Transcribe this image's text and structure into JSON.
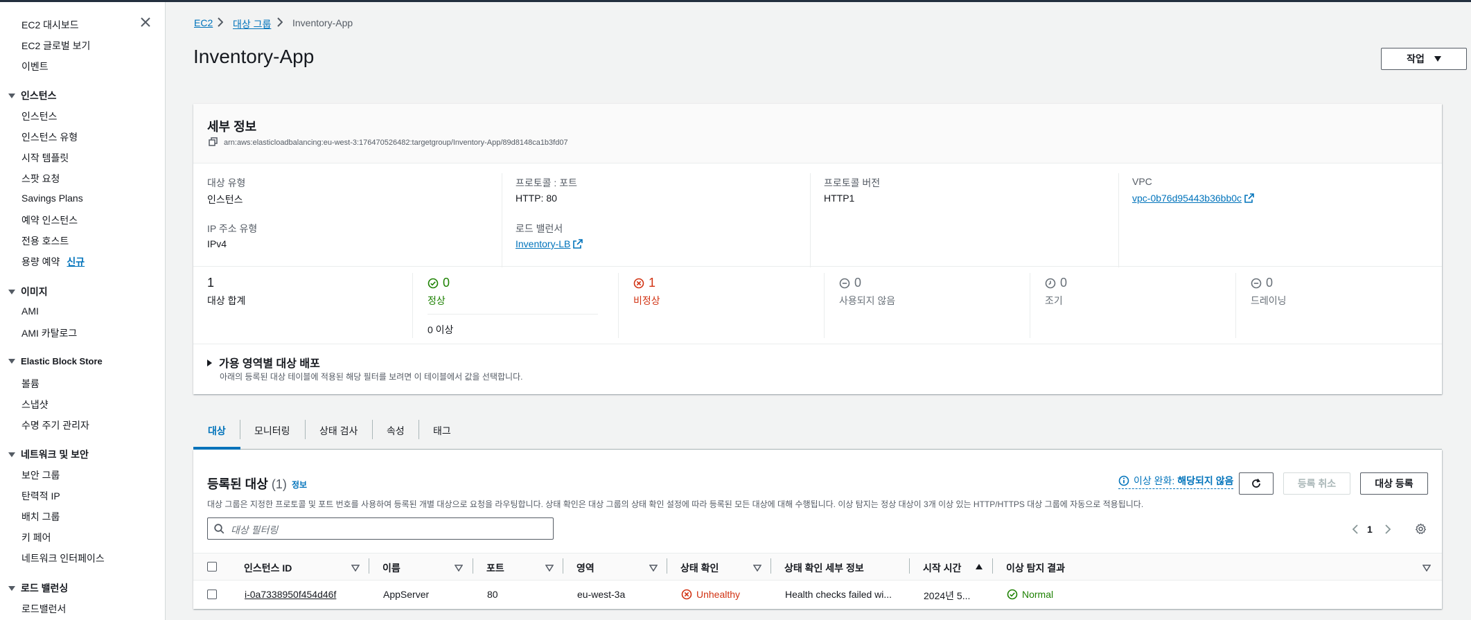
{
  "sidebar": {
    "items_top": [
      "EC2 대시보드",
      "EC2 글로벌 보기",
      "이벤트"
    ],
    "sec_instances": "인스턴스",
    "instances": [
      "인스턴스",
      "인스턴스 유형",
      "시작 템플릿",
      "스팟 요청",
      "Savings Plans",
      "예약 인스턴스",
      "전용 호스트",
      "용량 예약"
    ],
    "new_badge": "신규",
    "sec_images": "이미지",
    "images": [
      "AMI",
      "AMI 카탈로그"
    ],
    "sec_ebs": "Elastic Block Store",
    "ebs": [
      "볼륨",
      "스냅샷",
      "수명 주기 관리자"
    ],
    "sec_network": "네트워크 및 보안",
    "network": [
      "보안 그룹",
      "탄력적 IP",
      "배치 그룹",
      "키 페어",
      "네트워크 인터페이스"
    ],
    "sec_lb": "로드 밸런싱",
    "lb": [
      "로드밸런서"
    ]
  },
  "breadcrumb": {
    "ec2": "EC2",
    "target_groups": "대상 그룹",
    "current": "Inventory-App"
  },
  "page": {
    "title": "Inventory-App",
    "actions_label": "작업"
  },
  "details": {
    "title": "세부 정보",
    "arn": "arn:aws:elasticloadbalancing:eu-west-3:176470526482:targetgroup/Inventory-App/89d8148ca1b3fd07",
    "target_type_label": "대상 유형",
    "target_type_value": "인스턴스",
    "protocol_port_label": "프로토콜 : 포트",
    "protocol_port_value": "HTTP: 80",
    "protocol_version_label": "프로토콜 버전",
    "protocol_version_value": "HTTP1",
    "vpc_label": "VPC",
    "vpc_value": "vpc-0b76d95443b36bb0c",
    "ip_type_label": "IP 주소 유형",
    "ip_type_value": "IPv4",
    "lb_label": "로드 밸런서",
    "lb_value": "Inventory-LB"
  },
  "counts": {
    "total_value": "1",
    "total_label": "대상 합계",
    "healthy_value": "0",
    "healthy_label": "정상",
    "anomaly_value": "0 이상",
    "unhealthy_value": "1",
    "unhealthy_label": "비정상",
    "unused_value": "0",
    "unused_label": "사용되지 않음",
    "initial_value": "0",
    "initial_label": "조기",
    "draining_value": "0",
    "draining_label": "드레이닝"
  },
  "az": {
    "title": "가용 영역별 대상 배포",
    "desc": "아래의 등록된 대상 테이블에 적용된 해당 필터를 보려면 이 테이블에서 값을 선택합니다."
  },
  "tabs": [
    "대상",
    "모니터링",
    "상태 검사",
    "속성",
    "태그"
  ],
  "registered": {
    "title": "등록된 대상",
    "count": "(1)",
    "info": "정보",
    "mitigation_label": "이상 완화:",
    "mitigation_value": "해당되지 않음",
    "deregister_label": "등록 취소",
    "register_label": "대상 등록",
    "desc": "대상 그룹은 지정한 프로토콜 및 포트 번호를 사용하여 등록된 개별 대상으로 요청을 라우팅합니다. 상태 확인은 대상 그룹의 상태 확인 설정에 따라 등록된 모든 대상에 대해 수행됩니다. 이상 탐지는 정상 대상이 3개 이상 있는 HTTP/HTTPS 대상 그룹에 자동으로 적용됩니다.",
    "filter_placeholder": "대상 필터링",
    "page_number": "1"
  },
  "table": {
    "columns": [
      "인스턴스 ID",
      "이름",
      "포트",
      "영역",
      "상태 확인",
      "상태 확인 세부 정보",
      "시작 시간",
      "이상 탐지 결과"
    ],
    "rows": [
      {
        "instance_id": "i-0a7338950f454d46f",
        "name": "AppServer",
        "port": "80",
        "zone": "eu-west-3a",
        "health": "Unhealthy",
        "health_detail": "Health checks failed wi...",
        "launch_time": "2024년 5...",
        "anomaly": "Normal"
      }
    ]
  },
  "colors": {
    "link": "#0073bb",
    "success": "#1d8102",
    "error": "#d13212",
    "muted": "#687078"
  }
}
